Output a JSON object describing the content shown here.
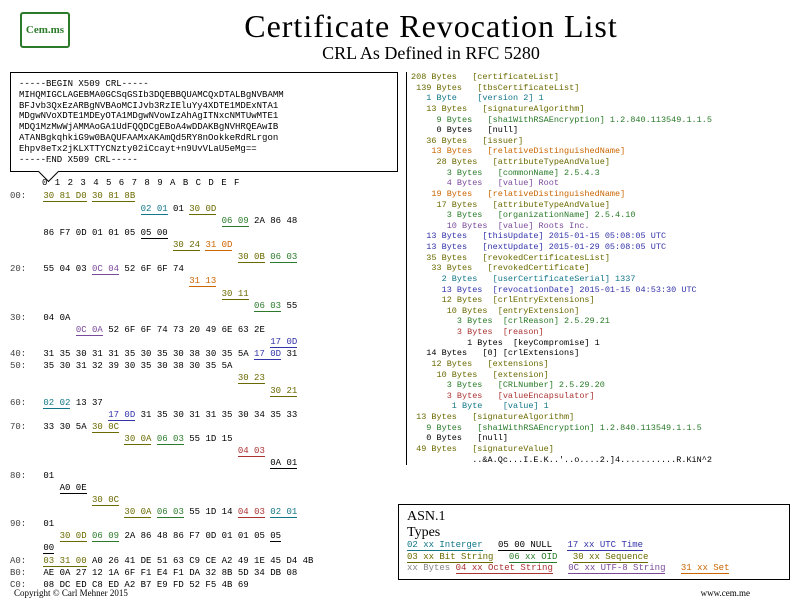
{
  "logo": "Cem.ms",
  "title": "Certificate Revocation List",
  "subtitle": "CRL As Defined in RFC 5280",
  "pem": {
    "begin": "-----BEGIN X509 CRL-----",
    "end": "-----END X509 CRL-----",
    "l1": "MIHQMIGCLAGEBMA0GCSqGSIb3DQEBBQUAMCQxDTALBgNVBAMM",
    "l2": "BFJvb3QxEzARBgNVBAoMCIJvb3RzIEluYy4XDTE1MDExNTA1",
    "l3": "MDgwNVoXDTE1MDEyOTA1MDgwNVowIzAhAgITNxcNMTUwMTE1",
    "l4": "MDQ1MzMwWjAMMAoGA1UdFQQDCgEBoA4wDDAKBgNVHRQEAwIB",
    "l5": "ATANBgkqhkiG9w0BAQUFAAMxAKAmQd5RY8nOokkeRdRLrgon",
    "l6": "Ehpv8eTx2jKLXTTYCNzty02iCcayt+n9UvVLaU5eMg=="
  },
  "hexheader": "0  1  2  3  4  5  6  7  8  9  A  B  C  D  E  F",
  "tree": {
    "l01": "208 Bytes   [certificateList]",
    "l02": " 139 Bytes   [tbsCertificateList]",
    "l03": "   1 Byte    [version 2] 1",
    "l04": "   13 Bytes   [signatureAlgorithm]",
    "l05": "     9 Bytes   [sha1WithRSAEncryption] 1.2.840.113549.1.1.5",
    "l06": "     0 Bytes   [null]",
    "l07": "   36 Bytes   [issuer]",
    "l08": "    13 Bytes   [relativeDistinguishedName]",
    "l09": "     28 Bytes   [attributeTypeAndValue]",
    "l10": "       3 Bytes   [commonName] 2.5.4.3",
    "l11": "       4 Bytes   [value] Root",
    "l12": "    19 Bytes   [relativeDistinguishedName]",
    "l13": "     17 Bytes   [attributeTypeAndValue]",
    "l14": "       3 Bytes   [organizationName] 2.5.4.10",
    "l15": "       10 Bytes  [value] Roots Inc.",
    "l16": "   13 Bytes   [thisUpdate] 2015-01-15 05:08:05 UTC",
    "l17": "   13 Bytes   [nextUpdate] 2015-01-29 05:08:05 UTC",
    "l18": "   35 Bytes   [revokedCertificatesList]",
    "l19": "    33 Bytes   [revokedCertificate]",
    "l20": "      2 Bytes   [userCertificateSerial] 1337",
    "l21": "      13 Bytes  [revocationDate] 2015-01-15 04:53:30 UTC",
    "l22": "      12 Bytes  [crlEntryExtensions]",
    "l23": "       10 Bytes  [entryExtension]",
    "l24": "         3 Bytes  [crlReason] 2.5.29.21",
    "l25": "         3 Bytes  [reason]",
    "l26": "           1 Bytes  [keyCompromise] 1",
    "l27": "   14 Bytes   [0] [crlExtensions]",
    "l28": "    12 Bytes   [extensions]",
    "l29": "     10 Bytes   [extension]",
    "l30": "       3 Bytes   [CRLNumber] 2.5.29.20",
    "l31": "       3 Bytes   [valueEncapsulator]",
    "l32": "        1 Byte    [value] 1",
    "l33": " 13 Bytes   [signatureAlgorithm]",
    "l34": "   9 Bytes   [sha1WithRSAEncryption] 1.2.840.113549.1.1.5",
    "l35": "   0 Bytes   [null]",
    "l36": " 49 Bytes   [signatureValue]",
    "l37": "            ..&A.Qc...I.E.K..'..o....2.]4...........R.KiN^2"
  },
  "legend": {
    "title1": "ASN.1",
    "title2": "Types",
    "int": "02 xx Interger",
    "nul": "05 00 NULL",
    "utc": "17 xx UTC Time",
    "bit": "03 xx Bit String",
    "oid": "06 xx OID",
    "seq": "30 xx Sequence",
    "oct": "04 xx Octet String",
    "utf": "0C xx UTF-8 String",
    "set": "31 xx Set",
    "xx": "xx Bytes"
  },
  "footer": {
    "copy": "Copyright © Carl Mehner 2015",
    "url": "www.cem.me"
  }
}
